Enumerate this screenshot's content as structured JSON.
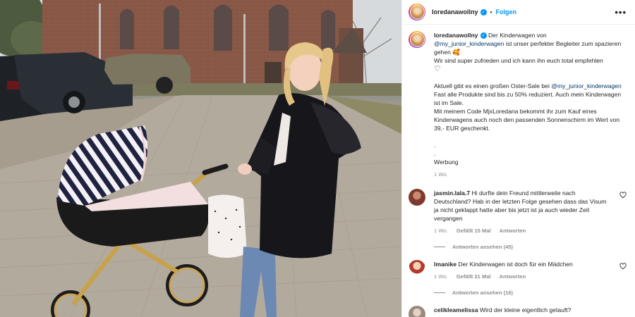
{
  "post": {
    "username": "loredanawollny",
    "verified_glyph": "✓",
    "separator": "•",
    "follow_label": "Folgen",
    "more_icon": "more-horizontal-icon",
    "caption": {
      "lead": "Der Kinderwagen von",
      "mention1": "@my_junior_kinderwagen",
      "line1_rest": "ist unser perfekter Begleiter zum spazieren gehen 🥰",
      "line2": "Wir sind super zufrieden und ich kann ihn euch total empfehlen",
      "heart": "♡",
      "p2a": "Aktuell gibt es einen großen Oster-Sale bei",
      "mention2": "@my_junior_kinderwagen",
      "p2b": "Fast alle Produkte sind bis zu 50% reduziert. Auch mein Kinderwagen ist im Sale.",
      "p3": "Mit meinem Code MjxLoredana bekommt ihr zum Kauf eines Kinderwagens auch noch den passenden Sonnenschirm im Wert von 39,- EUR geschenkt.",
      "dot1": ".",
      "dot2": ".",
      "tag": "Werbung"
    },
    "time": "1 Wo."
  },
  "comments": [
    {
      "username": "jasmin.lala.7",
      "text": "Hi durfte dein Freund mittlerweile nach Deutschland? Hab in der letzten Folge gesehen dass das Visum ja nicht geklappt hatte aber bis jetzt ist ja auch wieder Zeit vergangen",
      "time": "1 Wo.",
      "likes": "Gefällt 15 Mal",
      "reply_label": "Antworten",
      "view_replies": "Antworten ansehen (45)"
    },
    {
      "username": "lmanike",
      "text": "Der Kinderwagen ist doch für ein Mädchen",
      "time": "1 Wo.",
      "likes": "Gefällt 21 Mal",
      "reply_label": "Antworten",
      "view_replies": "Antworten ansehen (16)"
    },
    {
      "username": "celikleamelissa",
      "text": "Wird der kleine eigentlich getauft?"
    }
  ],
  "colors": {
    "accent": "#0095f6",
    "mention": "#00376b",
    "muted": "#8e8e8e"
  }
}
